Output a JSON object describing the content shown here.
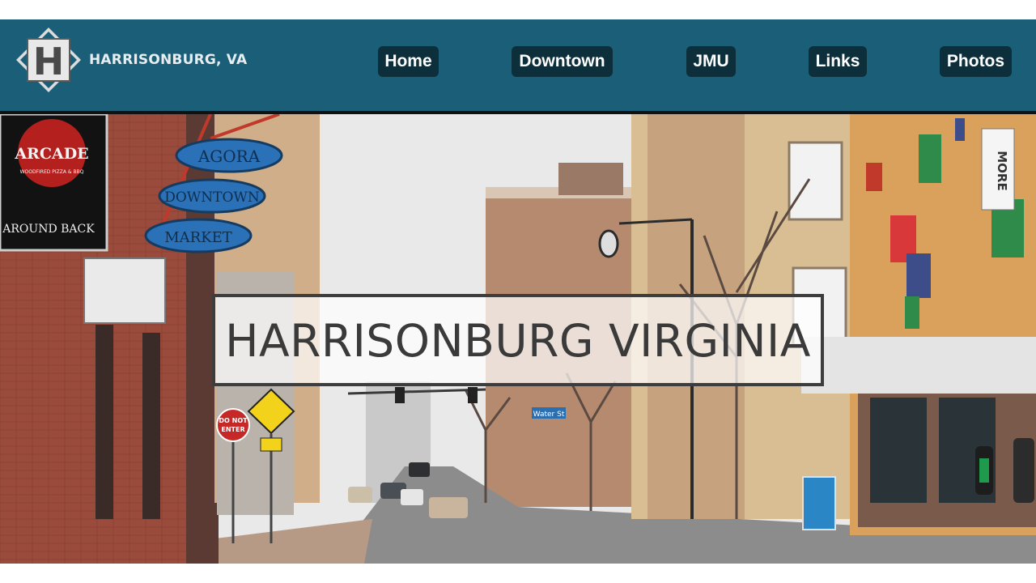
{
  "site": {
    "logo_letter": "H",
    "name": "HARRISONBURG, VA"
  },
  "nav": {
    "items": [
      {
        "label": "Home"
      },
      {
        "label": "Downtown"
      },
      {
        "label": "JMU"
      },
      {
        "label": "Links"
      },
      {
        "label": "Photos"
      }
    ]
  },
  "hero": {
    "title": "HARRISONBURG VIRGINIA",
    "image_alt": "Downtown Harrisonburg street scene",
    "signs": {
      "arcade": "ARCADE",
      "arcade_sub": "WOODFIRED PIZZA & BBQ",
      "around_back": "AROUND BACK",
      "agora": "AGORA",
      "downtown": "DOWNTOWN",
      "market": "MARKET",
      "do_not_enter_1": "DO NOT",
      "do_not_enter_2": "ENTER",
      "more": "MORE",
      "water_st": "Water St"
    }
  },
  "colors": {
    "header_bg": "#1b5e78",
    "nav_button_bg": "#0c2f3b",
    "nav_text": "#ffffff",
    "title_text": "#3a3a3a"
  }
}
